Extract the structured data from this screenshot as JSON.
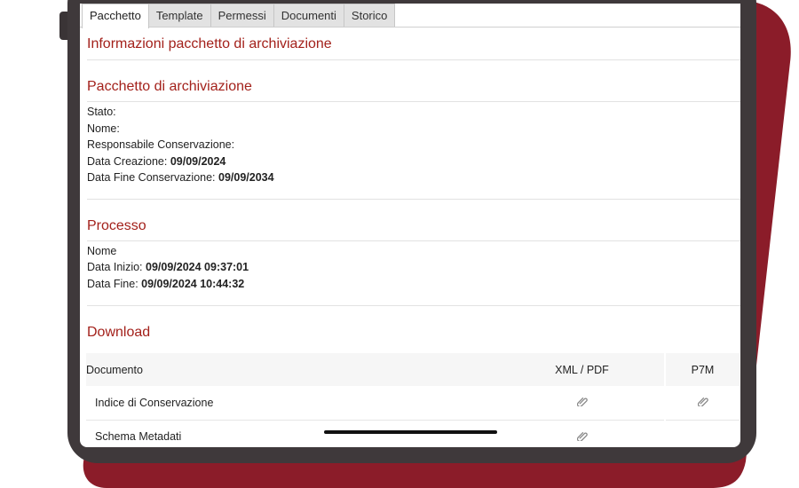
{
  "tabs": [
    {
      "label": "Pacchetto",
      "active": true
    },
    {
      "label": "Template"
    },
    {
      "label": "Permessi"
    },
    {
      "label": "Documenti"
    },
    {
      "label": "Storico"
    }
  ],
  "page_title": "Informazioni pacchetto di archiviazione",
  "package": {
    "title": "Pacchetto di archiviazione",
    "stato_label": "Stato:",
    "nome_label": "Nome:",
    "responsabile_label": "Responsabile Conservazione:",
    "data_creazione_label": "Data Creazione:",
    "data_creazione_value": "09/09/2024",
    "data_fine_label": "Data Fine Conservazione:",
    "data_fine_value": "09/09/2034"
  },
  "process": {
    "title": "Processo",
    "nome_label": "Nome",
    "data_inizio_label": "Data Inizio:",
    "data_inizio_value": "09/09/2024 09:37:01",
    "data_fine_label": "Data Fine:",
    "data_fine_value": "09/09/2024 10:44:32"
  },
  "download": {
    "title": "Download",
    "headers": [
      "Documento",
      "XML / PDF",
      "P7M"
    ],
    "rows": [
      {
        "name": "Indice di Conservazione",
        "xml_pdf": "paperclip-icon",
        "p7m": "paperclip-icon"
      },
      {
        "name": "Schema Metadati",
        "xml_pdf": "paperclip-icon",
        "p7m": ""
      }
    ]
  },
  "colors": {
    "accent": "#a3211b",
    "background_shape": "#8b1c29",
    "frame": "#3f393b"
  }
}
